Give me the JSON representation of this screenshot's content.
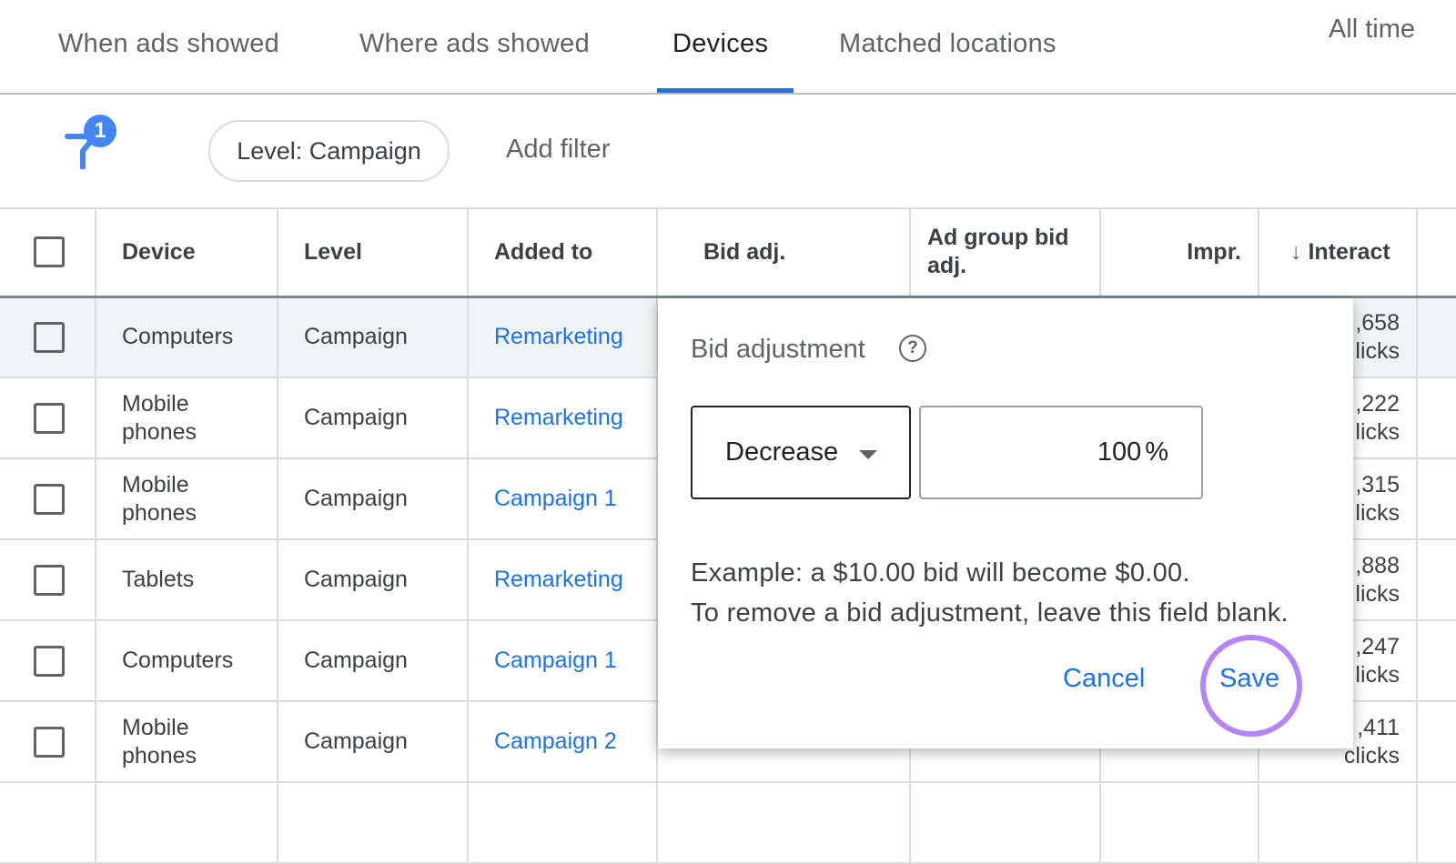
{
  "tabs": [
    {
      "label": "When ads showed"
    },
    {
      "label": "Where ads showed"
    },
    {
      "label": "Devices",
      "active": true
    },
    {
      "label": "Matched locations"
    }
  ],
  "date_range": "All time",
  "filter": {
    "icon": "filter-icon",
    "count": "1",
    "chip": "Level: Campaign",
    "add": "Add filter"
  },
  "table": {
    "headers": {
      "device": "Device",
      "level": "Level",
      "added_to": "Added to",
      "bid_adj": "Bid adj.",
      "ad_group_bid_adj": "Ad group bid adj.",
      "impr": "Impr.",
      "interactions": "Interact"
    },
    "sort_icon": "arrow-down-icon",
    "rows": [
      {
        "device": "Computers",
        "level": "Campaign",
        "added_to": "Remarketing",
        "interactions": ",658",
        "unit": "licks"
      },
      {
        "device": "Mobile phones",
        "level": "Campaign",
        "added_to": "Remarketing",
        "interactions": ",222",
        "unit": "licks"
      },
      {
        "device": "Mobile phones",
        "level": "Campaign",
        "added_to": "Campaign 1",
        "interactions": ",315",
        "unit": "licks"
      },
      {
        "device": "Tablets",
        "level": "Campaign",
        "added_to": "Remarketing",
        "interactions": ",888",
        "unit": "licks"
      },
      {
        "device": "Computers",
        "level": "Campaign",
        "added_to": "Campaign 1",
        "interactions": ",247",
        "unit": "licks"
      },
      {
        "device": "Mobile phones",
        "level": "Campaign",
        "added_to": "Campaign 2",
        "interactions": ",411",
        "unit": "clicks"
      }
    ]
  },
  "popup": {
    "title": "Bid adjustment",
    "direction": "Decrease",
    "value": "100",
    "unit": "%",
    "example": "Example: a $10.00 bid will become $0.00.",
    "hint": "To remove a bid adjustment, leave this field blank.",
    "cancel": "Cancel",
    "save": "Save",
    "highlight_color": "#b585f4"
  }
}
